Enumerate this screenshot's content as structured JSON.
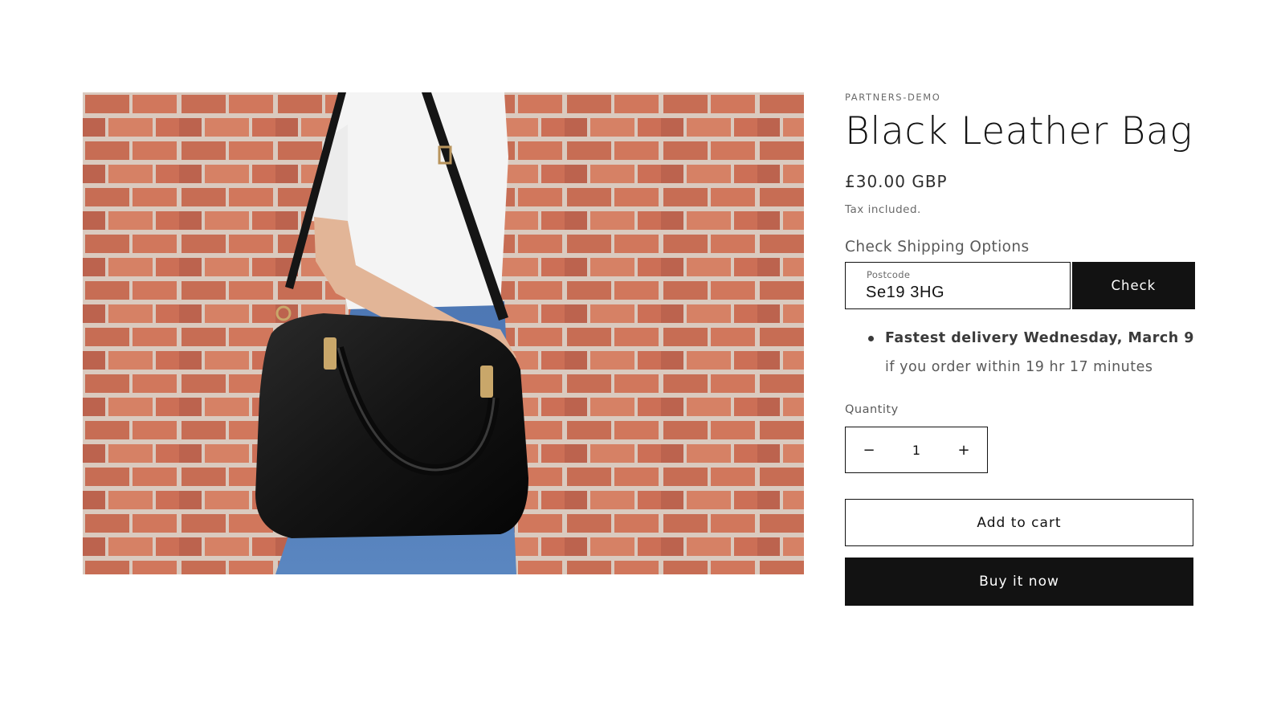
{
  "product": {
    "vendor": "PARTNERS-DEMO",
    "title": "Black Leather Bag",
    "price": "£30.00 GBP",
    "tax_note": "Tax included.",
    "image_alt": "Black Leather Bag"
  },
  "shipping": {
    "heading": "Check Shipping Options",
    "postcode_label": "Postcode",
    "postcode_value": "Se19 3HG",
    "check_label": "Check",
    "delivery_bold": "Fastest delivery Wednesday, March 9",
    "delivery_rest": " if you order within 19 hr 17 minutes"
  },
  "quantity": {
    "label": "Quantity",
    "value": "1",
    "decrease_symbol": "−",
    "increase_symbol": "+"
  },
  "actions": {
    "add_to_cart": "Add to cart",
    "buy_now": "Buy it now"
  },
  "colors": {
    "button_dark": "#121212",
    "brick": "#c5654a",
    "mortar": "#d9c8bc"
  }
}
